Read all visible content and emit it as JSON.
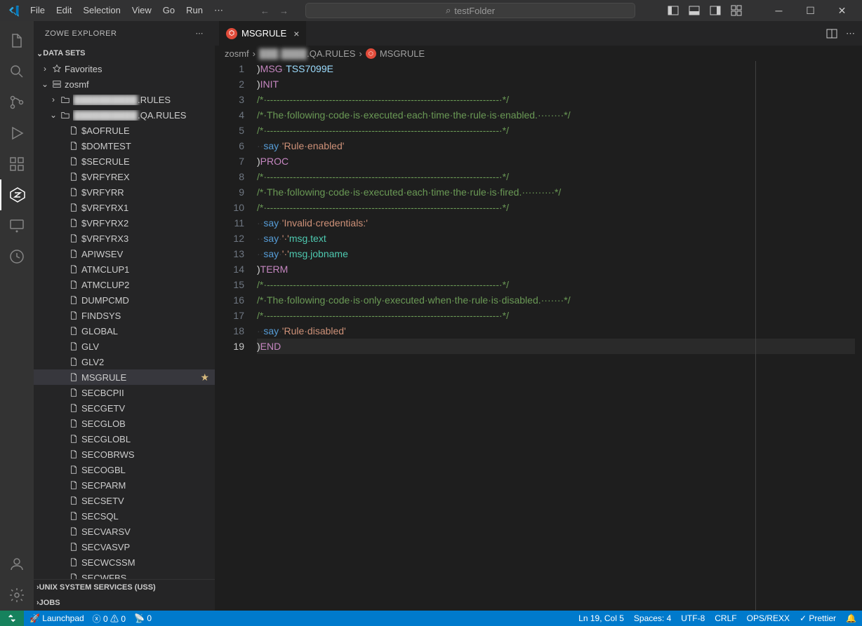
{
  "titlebar": {
    "menu": [
      "File",
      "Edit",
      "Selection",
      "View",
      "Go",
      "Run",
      "⋯"
    ],
    "search_placeholder": "testFolder"
  },
  "winControls": {
    "min": "─",
    "max": "☐",
    "close": "✕"
  },
  "sidebar": {
    "title": "ZOWE EXPLORER",
    "sections": {
      "datasets": "DATA SETS",
      "uss": "UNIX SYSTEM SERVICES (USS)",
      "jobs": "JOBS"
    },
    "favorites": "Favorites",
    "profile": "zosmf",
    "folders": [
      {
        "label_suffix": ".RULES",
        "blurred": true,
        "expanded": false
      },
      {
        "label_suffix": ".QA.RULES",
        "blurred": true,
        "expanded": true
      }
    ],
    "members": [
      "$AOFRULE",
      "$DOMTEST",
      "$SECRULE",
      "$VRFYREX",
      "$VRFYRR",
      "$VRFYRX1",
      "$VRFYRX2",
      "$VRFYRX3",
      "APIWSEV",
      "ATMCLUP1",
      "ATMCLUP2",
      "DUMPCMD",
      "FINDSYS",
      "GLOBAL",
      "GLV",
      "GLV2",
      "MSGRULE",
      "SECBCPII",
      "SECGETV",
      "SECGLOB",
      "SECGLOBL",
      "SECOBRWS",
      "SECOGBL",
      "SECPARM",
      "SECSETV",
      "SECSQL",
      "SECVARSV",
      "SECVASVP",
      "SECWCSSM",
      "SECWFBS"
    ],
    "selected_member": "MSGRULE"
  },
  "tabs": {
    "active": "MSGRULE"
  },
  "breadcrumbs": [
    "zosmf",
    "███.████.QA.RULES",
    "MSGRULE"
  ],
  "editor": {
    "lines": [
      [
        {
          "c": "k-paren",
          "t": ")"
        },
        {
          "c": "k-directive",
          "t": "MSG"
        },
        {
          "c": "ws-dot",
          "t": "·"
        },
        {
          "c": "k-ident",
          "t": "TSS7099E"
        }
      ],
      [
        {
          "c": "k-paren",
          "t": ")"
        },
        {
          "c": "k-directive",
          "t": "INIT"
        }
      ],
      [
        {
          "c": "k-comment",
          "t": "/*·-----------------------------------------------------------------------·*/"
        }
      ],
      [
        {
          "c": "k-comment",
          "t": "/*·The·following·code·is·executed·each·time·the·rule·is·enabled.········*/"
        }
      ],
      [
        {
          "c": "k-comment",
          "t": "/*·-----------------------------------------------------------------------·*/"
        }
      ],
      [
        {
          "c": "ws-dot",
          "t": "··"
        },
        {
          "c": "k-cmd",
          "t": "say"
        },
        {
          "c": "ws-dot",
          "t": "·"
        },
        {
          "c": "k-str",
          "t": "'Rule·enabled'"
        }
      ],
      [
        {
          "c": "k-paren",
          "t": ")"
        },
        {
          "c": "k-directive",
          "t": "PROC"
        }
      ],
      [
        {
          "c": "k-comment",
          "t": "/*·-----------------------------------------------------------------------·*/"
        }
      ],
      [
        {
          "c": "k-comment",
          "t": "/*·The·following·code·is·executed·each·time·the·rule·is·fired.··········*/"
        }
      ],
      [
        {
          "c": "k-comment",
          "t": "/*·-----------------------------------------------------------------------·*/"
        }
      ],
      [
        {
          "c": "ws-dot",
          "t": "··"
        },
        {
          "c": "k-cmd",
          "t": "say"
        },
        {
          "c": "ws-dot",
          "t": "·"
        },
        {
          "c": "k-str",
          "t": "'Invalid·credentials:'"
        }
      ],
      [
        {
          "c": "ws-dot",
          "t": "··"
        },
        {
          "c": "k-cmd",
          "t": "say"
        },
        {
          "c": "ws-dot",
          "t": "·"
        },
        {
          "c": "k-str",
          "t": "'·'"
        },
        {
          "c": "k-prop",
          "t": "msg.text"
        }
      ],
      [
        {
          "c": "ws-dot",
          "t": "··"
        },
        {
          "c": "k-cmd",
          "t": "say"
        },
        {
          "c": "ws-dot",
          "t": "·"
        },
        {
          "c": "k-str",
          "t": "'·'"
        },
        {
          "c": "k-prop",
          "t": "msg.jobname"
        }
      ],
      [
        {
          "c": "k-paren",
          "t": ")"
        },
        {
          "c": "k-directive",
          "t": "TERM"
        }
      ],
      [
        {
          "c": "k-comment",
          "t": "/*·-----------------------------------------------------------------------·*/"
        }
      ],
      [
        {
          "c": "k-comment",
          "t": "/*·The·following·code·is·only·executed·when·the·rule·is·disabled.·······*/"
        }
      ],
      [
        {
          "c": "k-comment",
          "t": "/*·-----------------------------------------------------------------------·*/"
        }
      ],
      [
        {
          "c": "ws-dot",
          "t": "··"
        },
        {
          "c": "k-cmd",
          "t": "say"
        },
        {
          "c": "ws-dot",
          "t": "·"
        },
        {
          "c": "k-str",
          "t": "'Rule·disabled'"
        }
      ],
      [
        {
          "c": "k-paren",
          "t": ")"
        },
        {
          "c": "k-directive",
          "t": "END"
        }
      ]
    ],
    "active_line": 19
  },
  "statusbar": {
    "launchpad": "Launchpad",
    "errors": "0",
    "warnings": "0",
    "ports": "0",
    "position": "Ln 19, Col 5",
    "spaces": "Spaces: 4",
    "encoding": "UTF-8",
    "eol": "CRLF",
    "language": "OPS/REXX",
    "prettier": "Prettier"
  }
}
